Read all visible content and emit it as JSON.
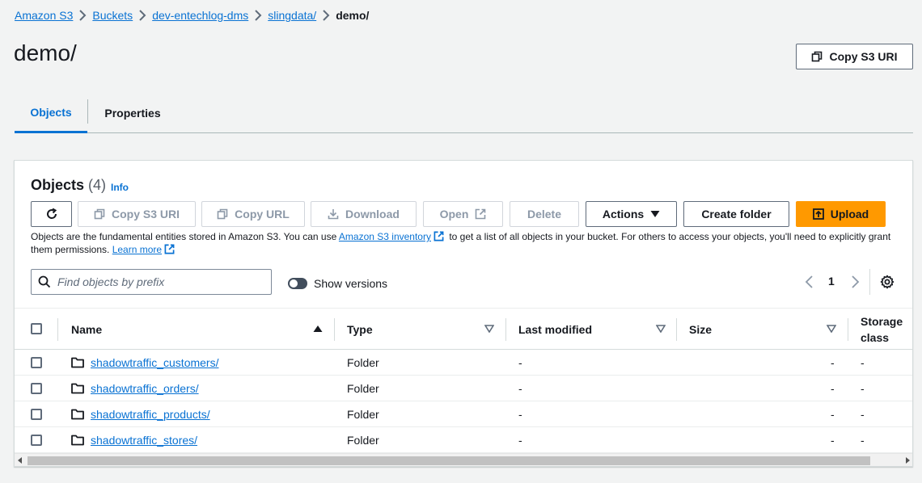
{
  "breadcrumb": {
    "items": [
      "Amazon S3",
      "Buckets",
      "dev-entechlog-dms",
      "slingdata/"
    ],
    "current": "demo/"
  },
  "page": {
    "title": "demo/",
    "copy_s3_uri_label": "Copy S3 URI"
  },
  "tabs": [
    {
      "label": "Objects",
      "active": true
    },
    {
      "label": "Properties",
      "active": false
    }
  ],
  "objects_panel": {
    "title": "Objects",
    "count": "(4)",
    "info_label": "Info",
    "toolbar": {
      "copy_s3_uri": "Copy S3 URI",
      "copy_url": "Copy URL",
      "download": "Download",
      "open": "Open",
      "delete": "Delete",
      "actions": "Actions",
      "create_folder": "Create folder",
      "upload": "Upload"
    },
    "description": {
      "part1": "Objects are the fundamental entities stored in Amazon S3. You can use ",
      "inventory_link": "Amazon S3 inventory",
      "part2": " to get a list of all objects in your bucket. For others to access your objects, you'll need to explicitly grant them permissions. ",
      "learn_more": "Learn more"
    },
    "search_placeholder": "Find objects by prefix",
    "show_versions_label": "Show versions",
    "page_number": "1"
  },
  "table": {
    "columns": {
      "name": "Name",
      "type": "Type",
      "last_modified": "Last modified",
      "size": "Size",
      "storage_class_1": "Storage",
      "storage_class_2": "class"
    },
    "rows": [
      {
        "name": "shadowtraffic_customers/",
        "type": "Folder",
        "last_modified": "-",
        "size": "-",
        "storage_class": "-"
      },
      {
        "name": "shadowtraffic_orders/",
        "type": "Folder",
        "last_modified": "-",
        "size": "-",
        "storage_class": "-"
      },
      {
        "name": "shadowtraffic_products/",
        "type": "Folder",
        "last_modified": "-",
        "size": "-",
        "storage_class": "-"
      },
      {
        "name": "shadowtraffic_stores/",
        "type": "Folder",
        "last_modified": "-",
        "size": "-",
        "storage_class": "-"
      }
    ]
  },
  "colors": {
    "link": "#0972d3",
    "primary": "#ff9900",
    "background": "#f2f3f3"
  }
}
